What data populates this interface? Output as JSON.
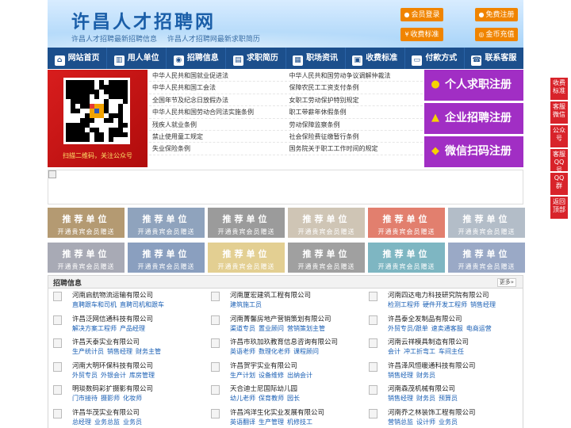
{
  "header": {
    "title": "许昌人才招聘网",
    "subtitles": [
      "许昌人才招聘最新招聘信息",
      "许昌人才招聘网最新求职简历"
    ],
    "buttons": [
      {
        "label": "会员登录",
        "icon": "user-icon"
      },
      {
        "label": "免费注册",
        "icon": "user-plus-icon"
      },
      {
        "label": "收费标准",
        "icon": "yen-icon"
      },
      {
        "label": "金币充值",
        "icon": "coin-icon"
      }
    ]
  },
  "nav": {
    "items": [
      {
        "label": "网站首页",
        "icon": "home-icon"
      },
      {
        "label": "用人单位",
        "icon": "building-icon"
      },
      {
        "label": "招聘信息",
        "icon": "recruit-icon"
      },
      {
        "label": "求职简历",
        "icon": "resume-icon"
      },
      {
        "label": "职场资讯",
        "icon": "news-icon"
      },
      {
        "label": "收费标准",
        "icon": "fee-icon"
      },
      {
        "label": "付款方式",
        "icon": "payment-icon"
      },
      {
        "label": "联系客服",
        "icon": "phone-icon"
      }
    ]
  },
  "qr": {
    "caption": "扫描二维码，关注公众号"
  },
  "laws": [
    [
      "中华人民共和国就业促进法",
      "中华人民共和国劳动争议调解仲裁法"
    ],
    [
      "中华人民共和国工会法",
      "保障农民工工资支付条例"
    ],
    [
      "全国年节及纪念日放假办法",
      "女职工劳动保护特别规定"
    ],
    [
      "中华人民共和国劳动合同法实施条例",
      "职工带薪年休假条例"
    ],
    [
      "残疾人就业条例",
      "劳动保障监察条例"
    ],
    [
      "禁止使用童工规定",
      "社会保险费征缴暂行条例"
    ],
    [
      "失业保险条例",
      "国务院关于职工工作时间的规定"
    ]
  ],
  "register": [
    {
      "label": "个人求职注册",
      "icon": "person-icon"
    },
    {
      "label": "企业招聘注册",
      "icon": "company-icon"
    },
    {
      "label": "微信扫码注册",
      "icon": "wechat-icon"
    }
  ],
  "recommend": {
    "title": "推荐单位",
    "subtitle": "开通贵宾会员赠送",
    "colors": [
      "#b49a72",
      "#8fa3bd",
      "#9b9b9b",
      "#cfc5b5",
      "#e27f6e",
      "#b3bdc8",
      "#a8aab5",
      "#8a9fbf",
      "#e3cf92",
      "#a0a0a0",
      "#7eb6c2",
      "#9aa9c6"
    ]
  },
  "jobs": {
    "title": "招聘信息",
    "more": "更多»",
    "rows": [
      [
        {
          "company": "河南启航物流运输有限公司",
          "positions": [
            "直聘跟车和司机",
            "直聘司机和跟车"
          ]
        },
        {
          "company": "河南厦宏建筑工程有限公司",
          "positions": [
            "建筑施工员"
          ]
        },
        {
          "company": "河南四达电力科技研究院有限公司",
          "positions": [
            "检测工程师",
            "硬件开发工程师",
            "销售经理"
          ]
        }
      ],
      [
        {
          "company": "许昌泛网信通科技有限公司",
          "positions": [
            "解决方案工程师",
            "产品经理"
          ]
        },
        {
          "company": "河南菁馨房地产营销策划有限公司",
          "positions": [
            "渠道专员",
            "置业顾问",
            "营销策划主管"
          ]
        },
        {
          "company": "许昌泰全发制品有限公司",
          "positions": [
            "外贸专员/跟单",
            "速卖通客服",
            "电商运营"
          ]
        }
      ],
      [
        {
          "company": "许昌天泰实业有限公司",
          "positions": [
            "生产统计员",
            "销售经理",
            "财务主管"
          ]
        },
        {
          "company": "许昌市玖加玖教育信息咨询有限公司",
          "positions": [
            "英语老师",
            "数理化老师",
            "课程顾问"
          ]
        },
        {
          "company": "河南云祥模具制造有限公司",
          "positions": [
            "会计",
            "冲工折弯工",
            "车间主任"
          ]
        }
      ],
      [
        {
          "company": "河南大明环保科技有限公司",
          "positions": [
            "外贸专员",
            "外银会计",
            "库房管理"
          ]
        },
        {
          "company": "许昌贺宇实业有限公司",
          "positions": [
            "生产计划",
            "设备维修",
            "出纳会计"
          ]
        },
        {
          "company": "许昌泽风恒暖通科技有限公司",
          "positions": [
            "销售经理",
            "财务员"
          ]
        }
      ],
      [
        {
          "company": "明琰数码彩扩摄影有限公司",
          "positions": [
            "门市接待",
            "摄影师",
            "化妆师"
          ]
        },
        {
          "company": "天合迪士尼国际幼儿园",
          "positions": [
            "幼儿老师",
            "保育教师",
            "园长"
          ]
        },
        {
          "company": "河南森茂机械有限公司",
          "positions": [
            "销售经理",
            "财务员",
            "预算员"
          ]
        }
      ],
      [
        {
          "company": "许昌华茂实业有限公司",
          "positions": [
            "总经理",
            "业务总监",
            "业务员"
          ]
        },
        {
          "company": "许昌鸿洋生化实业发展有限公司",
          "positions": [
            "英语翻译",
            "生产管理",
            "机修技工"
          ]
        },
        {
          "company": "河南乔之林装饰工程有限公司",
          "positions": [
            "营销总监",
            "设计师",
            "业务员"
          ]
        }
      ]
    ]
  },
  "side": [
    {
      "label": "收费标准",
      "icon": ""
    },
    {
      "label": "客服微信",
      "icon": ""
    },
    {
      "label": "公众号",
      "icon": ""
    },
    {
      "label": "客服QQ号",
      "icon": ""
    },
    {
      "label": "QQ群",
      "icon": ""
    },
    {
      "label": "返回顶部",
      "icon": ""
    }
  ]
}
